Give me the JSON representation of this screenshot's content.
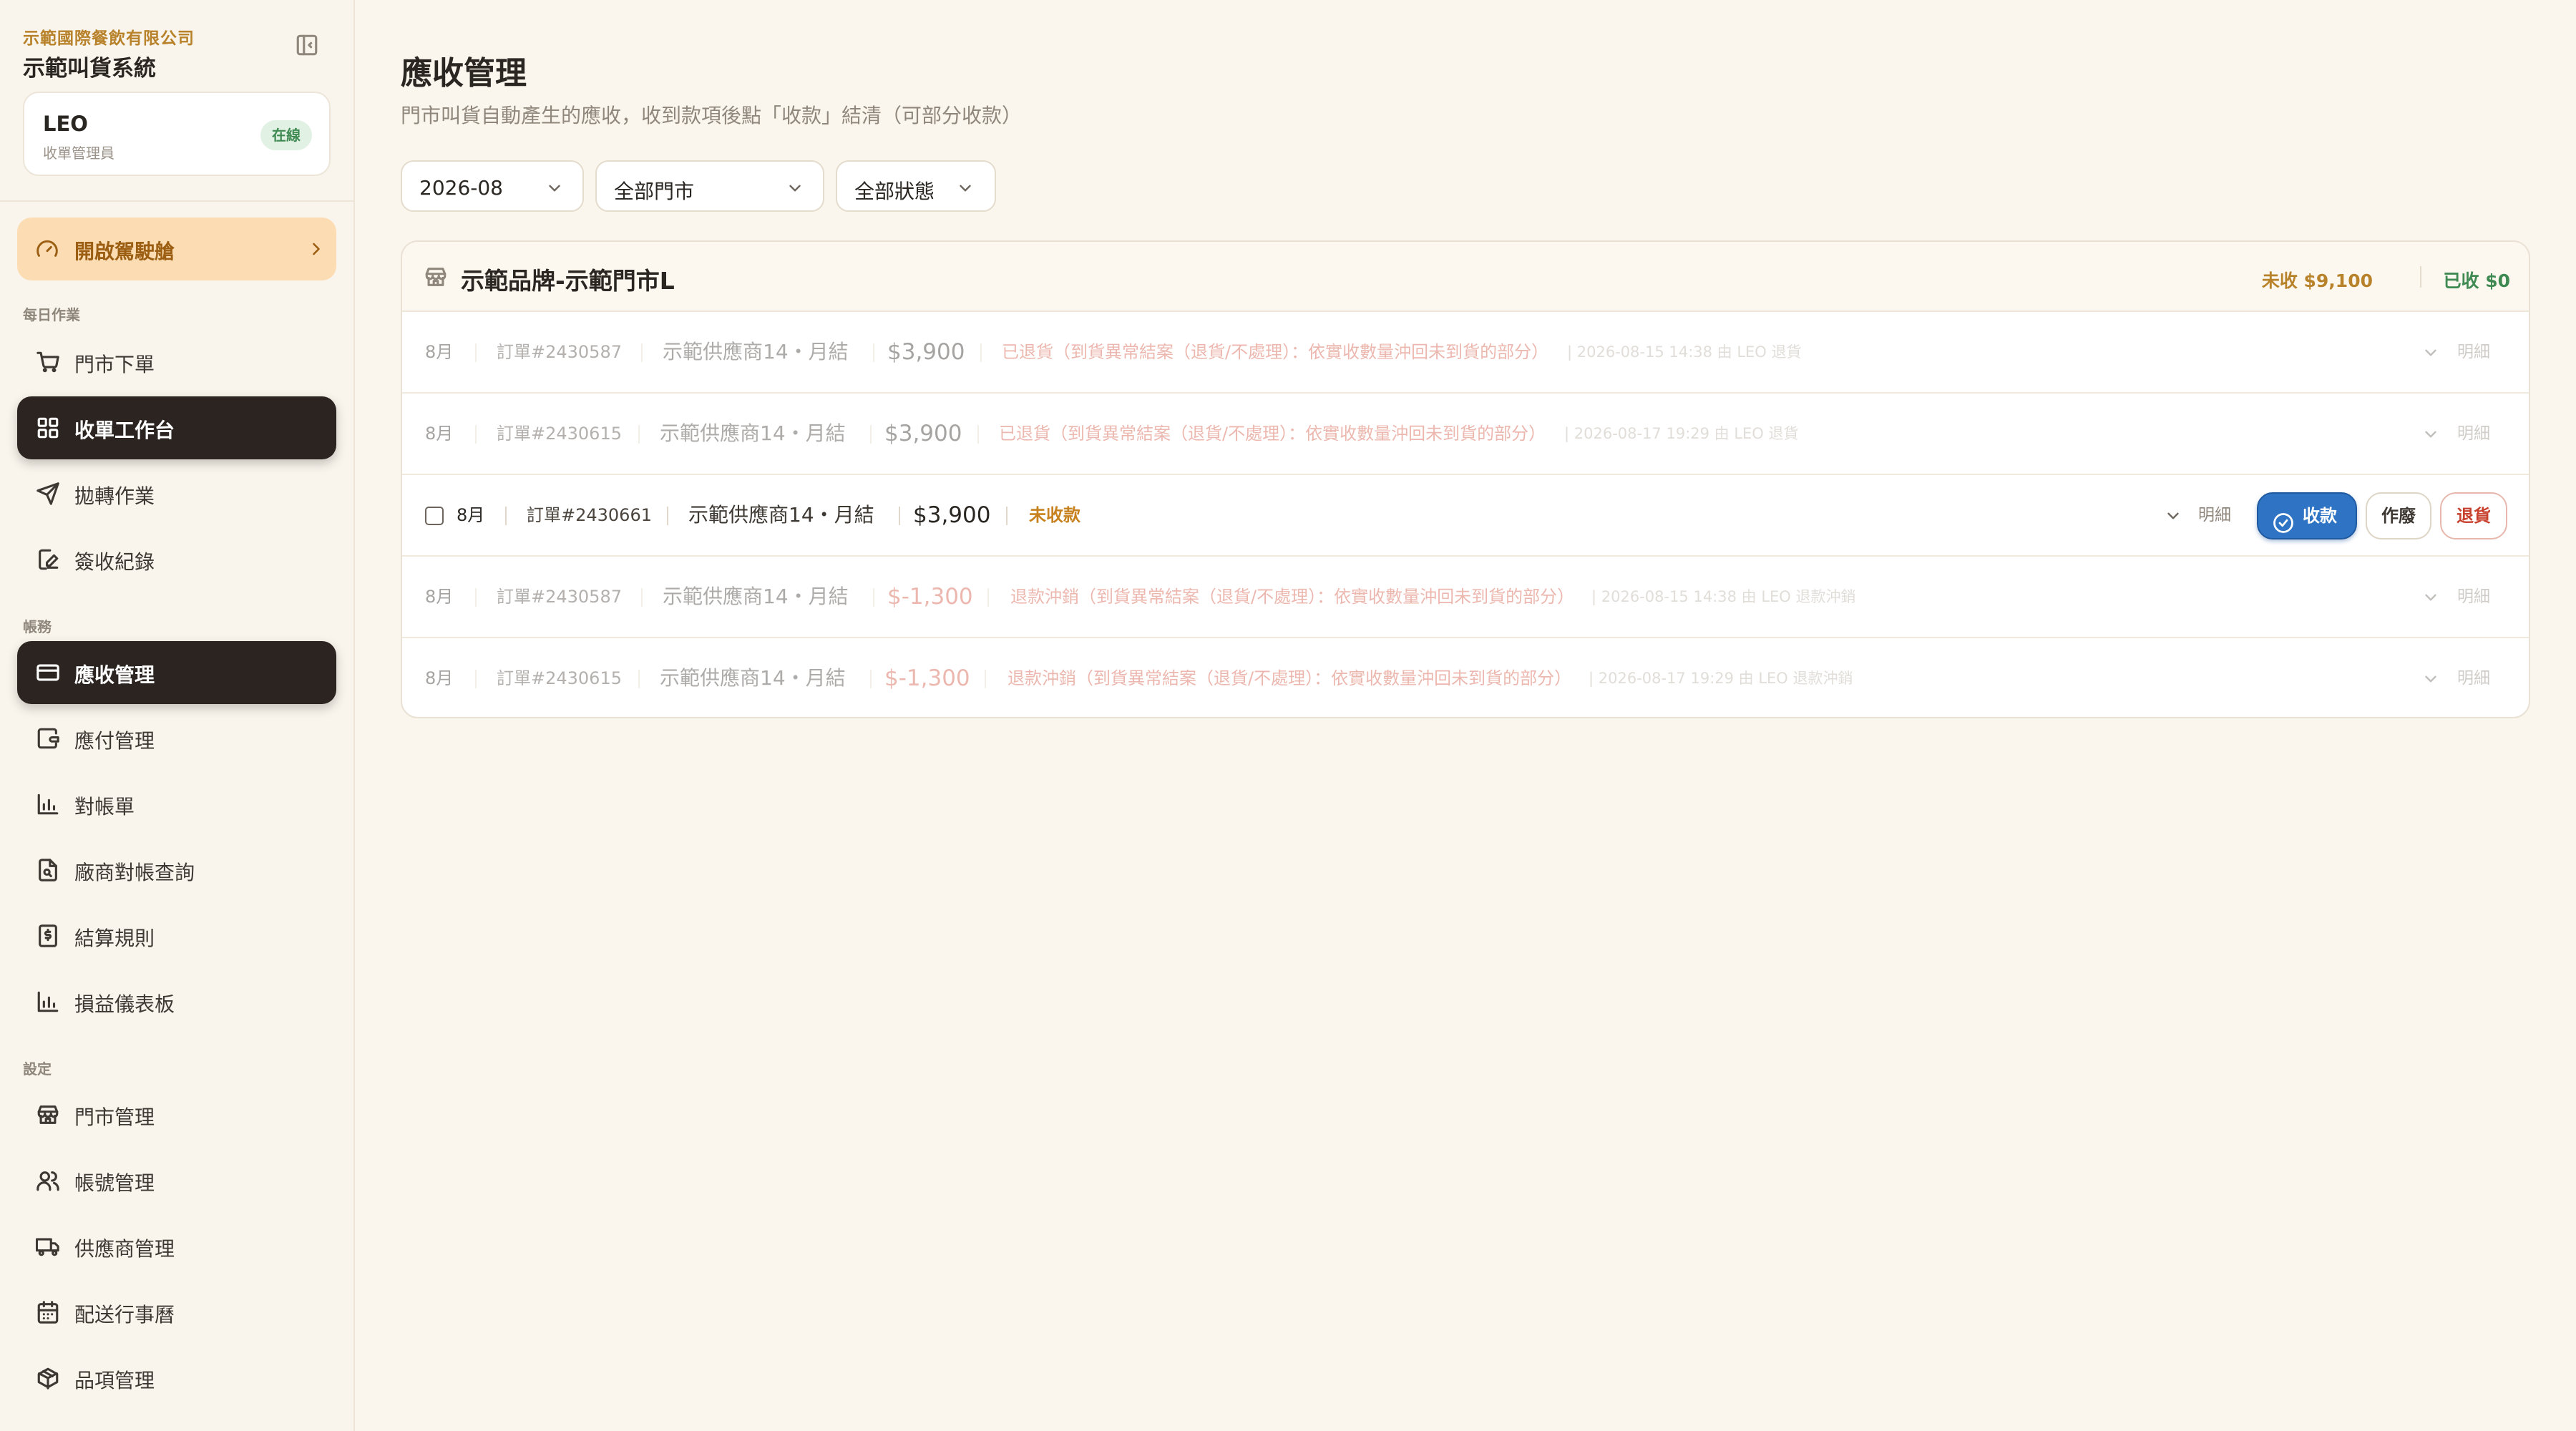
{
  "brand": {
    "company": "示範國際餐飲有限公司",
    "system": "示範叫貨系統"
  },
  "user": {
    "name": "LEO",
    "role": "收單管理員",
    "status": "在線"
  },
  "cockpit": {
    "label": "開啟駕駛艙"
  },
  "sidebar": {
    "sections": {
      "daily": "每日作業",
      "accounts": "帳務",
      "settings": "設定"
    },
    "items": [
      {
        "label": "門市下單",
        "icon": "cart-icon"
      },
      {
        "label": "收單工作台",
        "icon": "grid-icon",
        "active": true
      },
      {
        "label": "拋轉作業",
        "icon": "send-icon"
      },
      {
        "label": "簽收紀錄",
        "icon": "edit-icon"
      },
      {
        "label": "應收管理",
        "icon": "card-icon",
        "active": true
      },
      {
        "label": "應付管理",
        "icon": "wallet-icon"
      },
      {
        "label": "對帳單",
        "icon": "bar-chart-icon"
      },
      {
        "label": "廠商對帳查詢",
        "icon": "file-search-icon"
      },
      {
        "label": "結算規則",
        "icon": "receipt-icon"
      },
      {
        "label": "損益儀表板",
        "icon": "bar-chart-icon"
      },
      {
        "label": "門市管理",
        "icon": "store-icon"
      },
      {
        "label": "帳號管理",
        "icon": "users-icon"
      },
      {
        "label": "供應商管理",
        "icon": "truck-icon"
      },
      {
        "label": "配送行事曆",
        "icon": "calendar-icon"
      },
      {
        "label": "品項管理",
        "icon": "package-icon"
      }
    ]
  },
  "page": {
    "title": "應收管理",
    "subtitle": "門市叫貨自動產生的應收，收到款項後點「收款」結清（可部分收款）"
  },
  "filters": {
    "month": "2026-08",
    "store": "全部門市",
    "status": "全部狀態"
  },
  "store_group": {
    "name": "示範品牌-示範門市L",
    "unpaid": "未收 $9,100",
    "paid": "已收 $0"
  },
  "rows": [
    {
      "month": "8月",
      "order": "訂單#2430587",
      "supplier": "示範供應商14・月結",
      "amount": "$3,900",
      "status": "已退貨（到貨異常結案（退貨/不處理）：依實收數量沖回未到貨的部分）",
      "meta": "| 2026-08-15 14:38 由 LEO 退貨",
      "detail": "明細"
    },
    {
      "month": "8月",
      "order": "訂單#2430615",
      "supplier": "示範供應商14・月結",
      "amount": "$3,900",
      "status": "已退貨（到貨異常結案（退貨/不處理）：依實收數量沖回未到貨的部分）",
      "meta": "| 2026-08-17 19:29 由 LEO 退貨",
      "detail": "明細"
    },
    {
      "month": "8月",
      "order": "訂單#2430661",
      "supplier": "示範供應商14・月結",
      "amount": "$3,900",
      "status": "未收款",
      "detail": "明細",
      "actions": {
        "collect": "收款",
        "void": "作廢",
        "return": "退貨"
      }
    },
    {
      "month": "8月",
      "order": "訂單#2430587",
      "supplier": "示範供應商14・月結",
      "amount": "$-1,300",
      "status": "退款沖銷（到貨異常結案（退貨/不處理）：依實收數量沖回未到貨的部分）",
      "meta": "| 2026-08-15 14:38 由 LEO 退款沖銷",
      "detail": "明細"
    },
    {
      "month": "8月",
      "order": "訂單#2430615",
      "supplier": "示範供應商14・月結",
      "amount": "$-1,300",
      "status": "退款沖銷（到貨異常結案（退貨/不處理）：依實收數量沖回未到貨的部分）",
      "meta": "| 2026-08-17 19:29 由 LEO 退款沖銷",
      "detail": "明細"
    }
  ],
  "colors": {
    "accent": "#2f74c4",
    "sidebar_active": "#2b2420",
    "warning": "#c7821f",
    "danger": "#d2553f",
    "success": "#3f8a52"
  }
}
